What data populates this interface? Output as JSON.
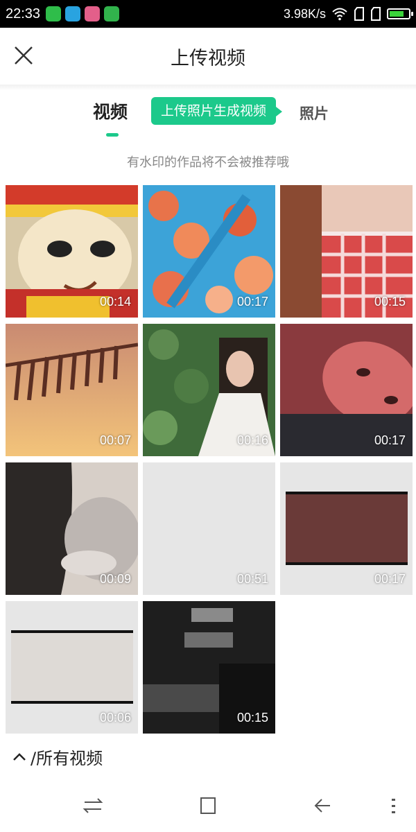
{
  "status_bar": {
    "time": "22:33",
    "speed": "3.98K/s",
    "battery_level": 0.75,
    "app_icons": [
      {
        "name": "wechat-app-icon",
        "color": "#2fbd4a"
      },
      {
        "name": "browser-app-icon",
        "color": "#29a3e0"
      },
      {
        "name": "gallery-app-icon",
        "color": "#e35f8a"
      },
      {
        "name": "usb-icon",
        "color": "#31b34c"
      }
    ]
  },
  "header": {
    "title": "上传视频"
  },
  "tabs": {
    "video": "视频",
    "promo": "上传照片生成视频",
    "photo": "照片"
  },
  "notice": "有水印的作品将不会被推荐哦",
  "videos": [
    {
      "duration": "00:14"
    },
    {
      "duration": "00:17"
    },
    {
      "duration": "00:15"
    },
    {
      "duration": "00:07"
    },
    {
      "duration": "00:16"
    },
    {
      "duration": "00:17"
    },
    {
      "duration": "00:09"
    },
    {
      "duration": "00:51"
    },
    {
      "duration": "00:17"
    },
    {
      "duration": "00:06"
    },
    {
      "duration": "00:15"
    }
  ],
  "album_selector": {
    "label": "/所有视频"
  },
  "colors": {
    "accent": "#1cc98b"
  }
}
